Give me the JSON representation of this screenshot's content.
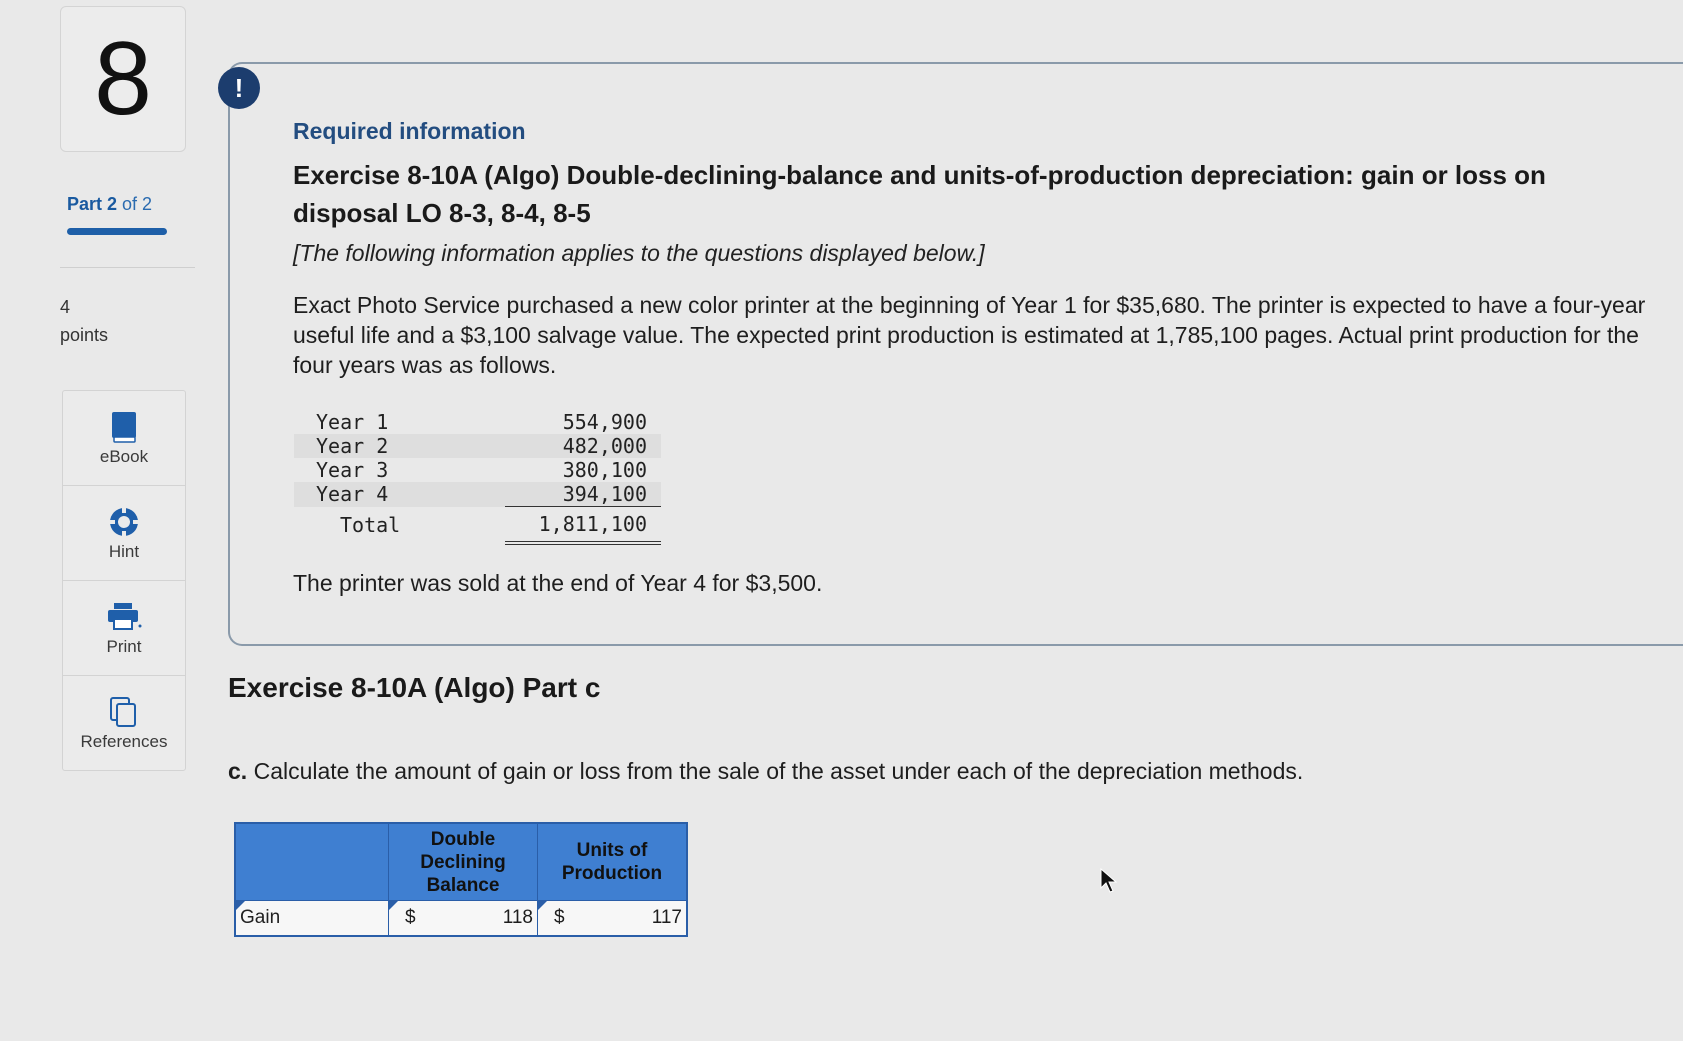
{
  "sidebar": {
    "question_number": "8",
    "part_prefix": "Part ",
    "part_current": "2",
    "part_suffix": " of 2",
    "points_value": "4",
    "points_label": "points",
    "tools": [
      {
        "label": "eBook",
        "icon": "book-icon"
      },
      {
        "label": "Hint",
        "icon": "lifebuoy-icon"
      },
      {
        "label": "Print",
        "icon": "printer-icon"
      },
      {
        "label": "References",
        "icon": "documents-icon"
      }
    ]
  },
  "info": {
    "alert_symbol": "!",
    "required_label": "Required information",
    "exercise_title": "Exercise 8-10A (Algo) Double-declining-balance and units-of-production depreciation: gain or loss on disposal LO 8-3, 8-4, 8-5",
    "applies_note": "[The following information applies to the questions displayed below.]",
    "paragraph": "Exact Photo Service purchased a new color printer at the beginning of Year 1 for $35,680. The printer is expected to have a four-year useful life and a $3,100 salvage value. The expected print production is estimated at 1,785,100 pages. Actual print production for the four years was as follows.",
    "production": [
      {
        "year": "Year 1",
        "value": "554,900"
      },
      {
        "year": "Year 2",
        "value": "482,000"
      },
      {
        "year": "Year 3",
        "value": "380,100"
      },
      {
        "year": "Year 4",
        "value": "394,100"
      }
    ],
    "total_label": "Total",
    "total_value": "1,811,100",
    "sold_note": "The printer was sold at the end of Year 4 for $3,500."
  },
  "part_c": {
    "title": "Exercise 8-10A (Algo) Part c",
    "question_letter": "c.",
    "question_text": " Calculate the amount of gain or loss from the sale of the asset under each of the depreciation methods.",
    "table": {
      "col1_line1": "Double",
      "col1_line2": "Declining",
      "col1_line3": "Balance",
      "col2_line1": "Units of",
      "col2_line2": "Production",
      "row_label": "Gain",
      "currency": "$",
      "ddb_value": "118",
      "uop_value": "117"
    }
  },
  "colors": {
    "accent_blue": "#3f7fd1",
    "border_blue": "#2a5ea8",
    "alert_navy": "#1c3d6e"
  }
}
